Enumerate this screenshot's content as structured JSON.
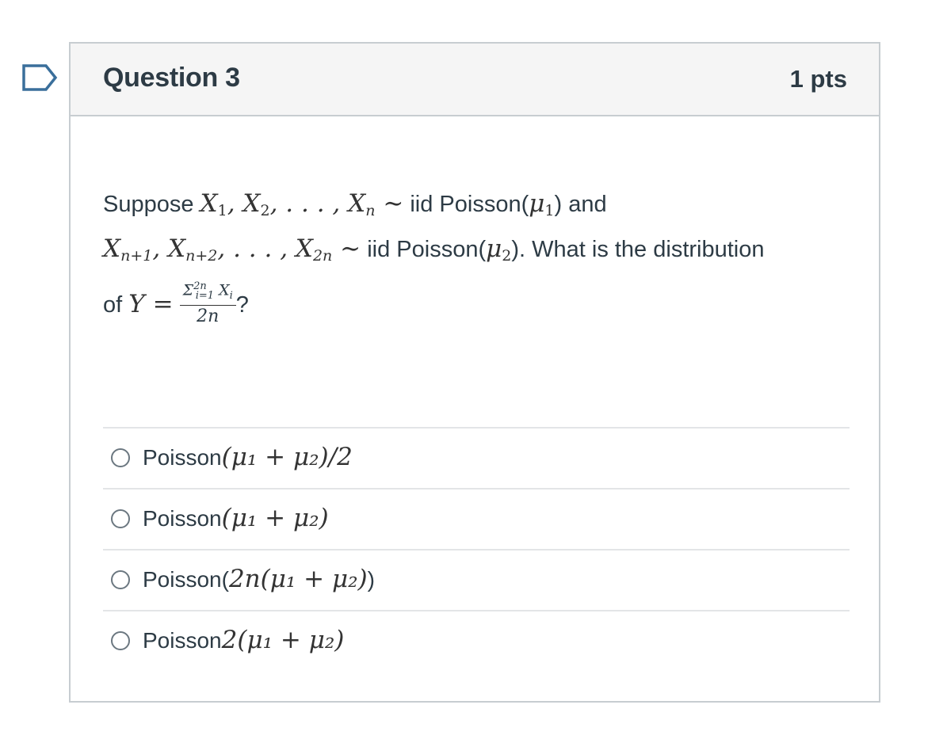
{
  "question": {
    "title": "Question 3",
    "points": "1 pts",
    "prompt": {
      "line1_intro": "Suppose ",
      "line1_mid": "iid Poisson(",
      "line1_end": ") and",
      "line2_mid": "iid Poisson(",
      "line2_end": "). What is the distribution",
      "line3_intro": "of ",
      "line3_end": "?"
    }
  },
  "answers": [
    {
      "prefix": "Poisson",
      "math": "(μ₁ + μ₂)/2",
      "suffix": ""
    },
    {
      "prefix": "Poisson",
      "math": "(μ₁ + μ₂)",
      "suffix": ""
    },
    {
      "prefix": "Poisson(",
      "math": "2n(μ₁ + μ₂)",
      "suffix": ")"
    },
    {
      "prefix": "Poisson",
      "math": "2(μ₁ + μ₂)",
      "suffix": ""
    }
  ],
  "colors": {
    "border": "#c7cdd1",
    "header_bg": "#f5f5f5",
    "text": "#2d3b45",
    "divider": "#e3e5e7"
  },
  "icons": {
    "flag": "flag-outline-icon",
    "radio": "radio-unchecked-icon"
  }
}
